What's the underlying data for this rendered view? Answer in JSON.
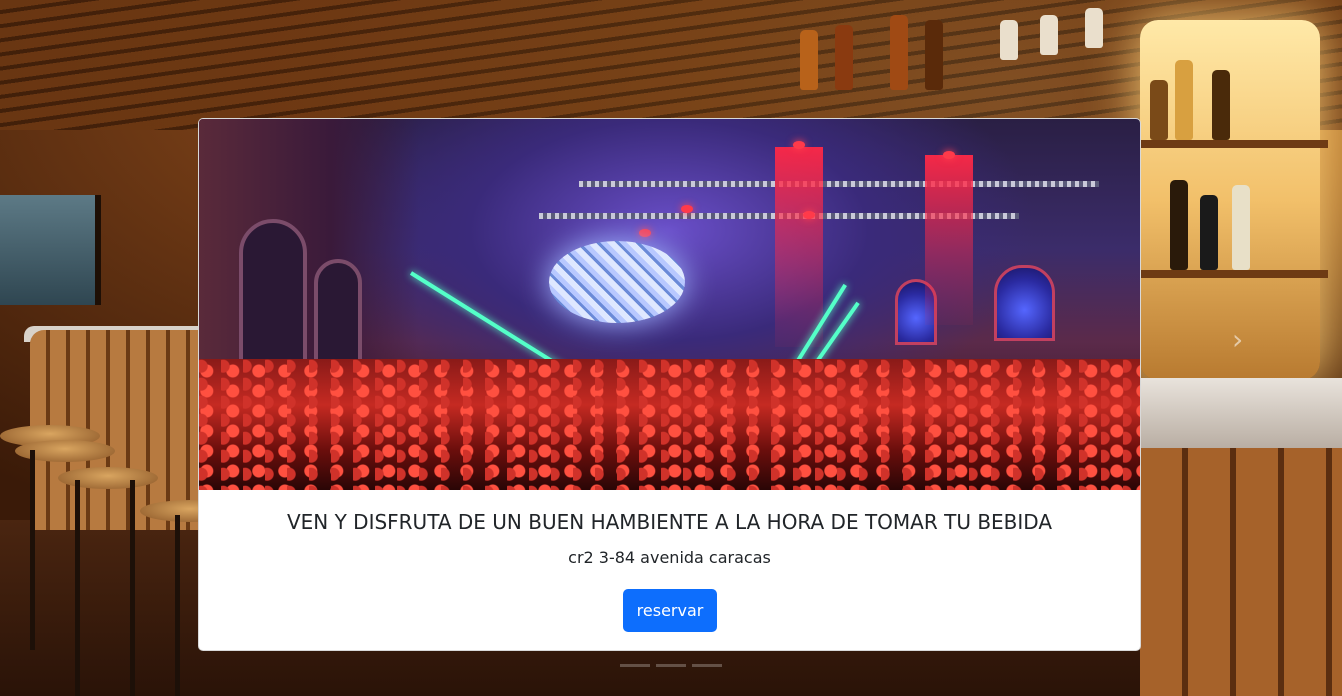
{
  "card": {
    "title": "VEN Y DISFRUTA DE UN BUEN HAMBIENTE A LA HORA DE TOMAR TU BEBIDA",
    "text": "cr2 3-84 avenida caracas",
    "button_label": "reservar",
    "button_color": "#0d6efd"
  },
  "carousel": {
    "next_icon": "chevron-right-icon",
    "next_glyph": "›"
  }
}
